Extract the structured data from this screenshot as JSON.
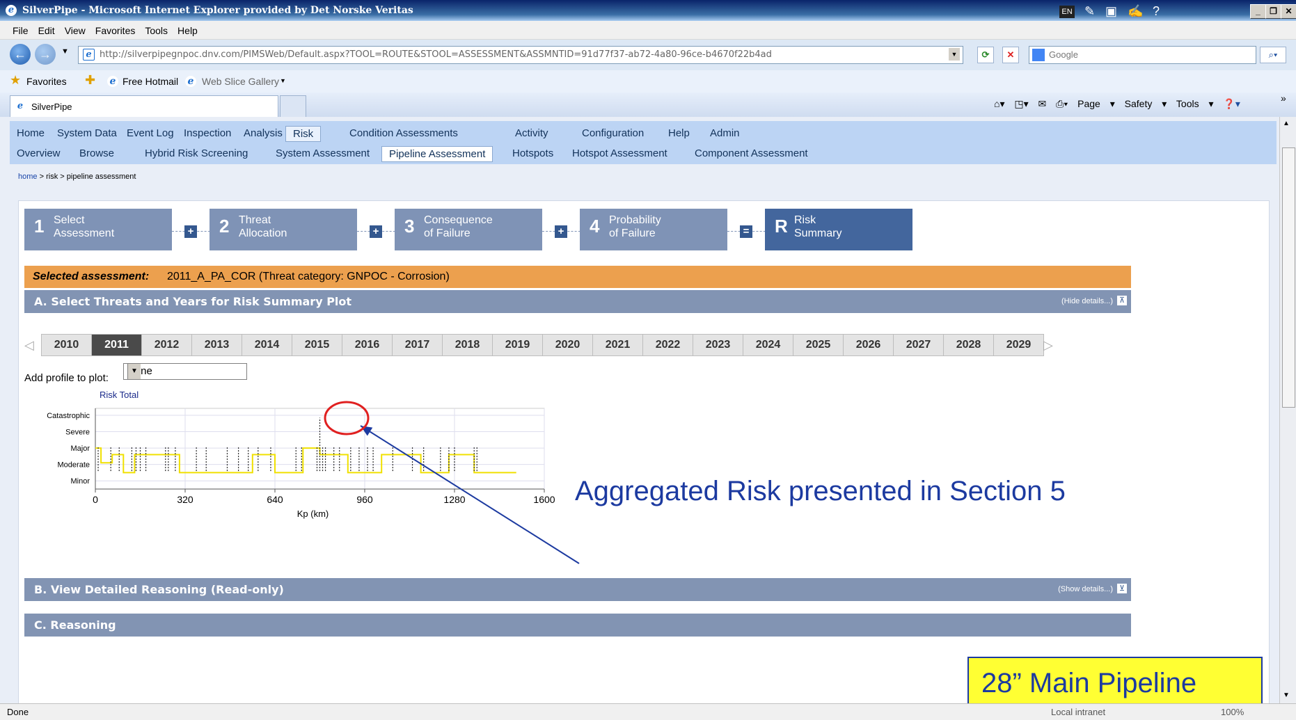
{
  "window": {
    "title": "SilverPipe - Microsoft Internet Explorer provided by Det Norske Veritas",
    "lang_badge": "EN"
  },
  "menubar": [
    "File",
    "Edit",
    "View",
    "Favorites",
    "Tools",
    "Help"
  ],
  "address": {
    "url": "http://silverpipegnpoc.dnv.com/PIMSWeb/Default.aspx?TOOL=ROUTE&STOOL=ASSESSMENT&ASSMNTID=91d77f37-ab72-4a80-96ce-b4670f22b4ad",
    "search_placeholder": "Google"
  },
  "favorites": {
    "favorites_label": "Favorites",
    "hotmail": "Free Hotmail",
    "webslice": "Web Slice Gallery"
  },
  "tab": {
    "title": "SilverPipe"
  },
  "commandbar": {
    "page": "Page",
    "safety": "Safety",
    "tools": "Tools"
  },
  "nav": {
    "main": [
      "Home",
      "System Data",
      "Event Log",
      "Inspection",
      "Analysis",
      "Risk",
      "Condition Assessments",
      "Activity",
      "Configuration",
      "Help",
      "Admin"
    ],
    "main_active": "Risk",
    "sub": [
      "Overview",
      "Browse",
      "Hybrid Risk Screening",
      "System Assessment",
      "Pipeline Assessment",
      "Hotspots",
      "Hotspot Assessment",
      "Component Assessment"
    ],
    "sub_active": "Pipeline Assessment"
  },
  "breadcrumb": {
    "home": "home",
    "sep": ">",
    "risk": "risk",
    "current": "pipeline assessment"
  },
  "steps": [
    {
      "num": "1",
      "l1": "Select",
      "l2": "Assessment"
    },
    {
      "num": "2",
      "l1": "Threat",
      "l2": "Allocation"
    },
    {
      "num": "3",
      "l1": "Consequence",
      "l2": "of Failure"
    },
    {
      "num": "4",
      "l1": "Probability",
      "l2": "of Failure"
    },
    {
      "num": "R",
      "l1": "Risk",
      "l2": "Summary"
    }
  ],
  "ops": [
    "+",
    "+",
    "+",
    "="
  ],
  "selected": {
    "label": "Selected assessment:",
    "value": "2011_A_PA_COR (Threat category: GNPOC - Corrosion)"
  },
  "sections": {
    "a": {
      "title": "A. Select Threats and Years for Risk Summary Plot",
      "toggle": "(Hide details...)"
    },
    "b": {
      "title": "B. View Detailed Reasoning (Read-only)",
      "toggle": "(Show details...)"
    },
    "c": {
      "title": "C. Reasoning"
    }
  },
  "years": [
    "2010",
    "2011",
    "2012",
    "2013",
    "2014",
    "2015",
    "2016",
    "2017",
    "2018",
    "2019",
    "2020",
    "2021",
    "2022",
    "2023",
    "2024",
    "2025",
    "2026",
    "2027",
    "2028",
    "2029"
  ],
  "selected_year": "2011",
  "profile": {
    "label": "Add profile to plot:",
    "value": "None"
  },
  "chart_data": {
    "type": "line",
    "title": "Risk Total",
    "xlabel": "Kp (km)",
    "ylabel": "",
    "xlim": [
      0,
      1600
    ],
    "x_ticks": [
      "0",
      "320",
      "640",
      "960",
      "1280",
      "1600"
    ],
    "y_categories": [
      "Minor",
      "Moderate",
      "Major",
      "Severe",
      "Catastrophic"
    ],
    "series": [
      {
        "color": "#f0e000",
        "points": [
          [
            0,
            3
          ],
          [
            20,
            3
          ],
          [
            20,
            2.1
          ],
          [
            60,
            2.1
          ],
          [
            60,
            2.6
          ],
          [
            100,
            2.6
          ],
          [
            100,
            1.5
          ],
          [
            140,
            1.5
          ],
          [
            140,
            2.6
          ],
          [
            300,
            2.6
          ],
          [
            300,
            1.5
          ],
          [
            560,
            1.5
          ],
          [
            560,
            2.6
          ],
          [
            640,
            2.6
          ],
          [
            640,
            1.5
          ],
          [
            740,
            1.5
          ],
          [
            740,
            3
          ],
          [
            800,
            3
          ],
          [
            800,
            2.6
          ],
          [
            900,
            2.6
          ],
          [
            900,
            1.5
          ],
          [
            1020,
            1.5
          ],
          [
            1020,
            2.6
          ],
          [
            1160,
            2.6
          ],
          [
            1160,
            1.5
          ],
          [
            1260,
            1.5
          ],
          [
            1260,
            2.6
          ],
          [
            1350,
            2.6
          ],
          [
            1350,
            1.5
          ],
          [
            1500,
            1.5
          ]
        ]
      }
    ],
    "spikes_kp": [
      10,
      55,
      85,
      130,
      145,
      160,
      180,
      250,
      260,
      285,
      360,
      395,
      470,
      510,
      545,
      580,
      625,
      715,
      735,
      790,
      800,
      810,
      820,
      850,
      870,
      910,
      940,
      970,
      990,
      1060,
      1130,
      1170,
      1230,
      1260,
      1280,
      1350,
      1360
    ],
    "spike_max_kp": 800,
    "highlight_kp": 805
  },
  "annotations": {
    "aggregated": "Aggregated Risk presented in Section 5",
    "pipeline": "28” Main Pipeline"
  },
  "status": {
    "text": "Done",
    "zone": "Local intranet",
    "zoom": "100%"
  }
}
